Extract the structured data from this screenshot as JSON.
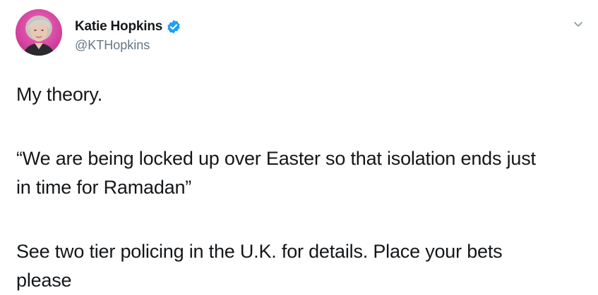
{
  "author": {
    "display_name": "Katie Hopkins",
    "handle": "@KTHopkins"
  },
  "icons": {
    "verified": "verified-badge-icon",
    "caret": "chevron-down-icon",
    "avatar": "avatar-photo"
  },
  "colors": {
    "verified_blue": "#1da1f2",
    "avatar_ring": "#d63fa0",
    "handle_gray": "#657786",
    "text": "#14171a"
  },
  "tweet": {
    "paragraphs": [
      "My theory.",
      "“We are being locked up over Easter so that isolation ends just in time for Ramadan”",
      "See two tier policing in the U.K. for details. Place your bets please"
    ]
  }
}
